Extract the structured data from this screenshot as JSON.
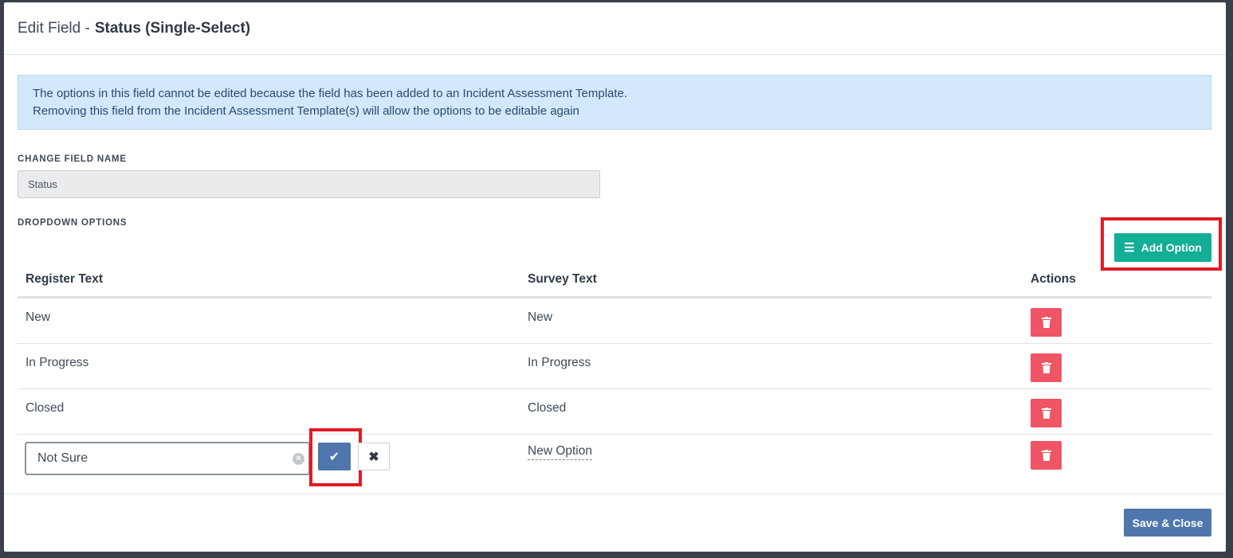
{
  "header": {
    "prefix": "Edit Field -",
    "title": "Status (Single-Select)"
  },
  "alert": {
    "line1": "The options in this field cannot be edited because the field has been added to an Incident Assessment Template.",
    "line2": "Removing this field from the Incident Assessment Template(s) will allow the options to be editable again"
  },
  "field_name": {
    "label": "CHANGE FIELD NAME",
    "value": "Status"
  },
  "dropdown": {
    "label": "DROPDOWN OPTIONS",
    "add_label": "Add Option"
  },
  "table": {
    "headers": {
      "register": "Register Text",
      "survey": "Survey Text",
      "actions": "Actions"
    },
    "rows": [
      {
        "register": "New",
        "survey": "New"
      },
      {
        "register": "In Progress",
        "survey": "In Progress"
      },
      {
        "register": "Closed",
        "survey": "Closed"
      }
    ],
    "edit_row": {
      "register_value": "Not Sure",
      "survey": "New Option"
    }
  },
  "footer": {
    "save_label": "Save & Close"
  },
  "icons": {
    "list": "list-icon",
    "trash": "trash-icon",
    "check": "check-icon",
    "close": "close-icon",
    "clear": "clear-input-icon"
  },
  "colors": {
    "add_button": "#12ae96",
    "delete_button": "#ef5564",
    "primary_button": "#4f76ad",
    "alert_bg": "#d3e8fb",
    "highlight": "#e21a23"
  }
}
